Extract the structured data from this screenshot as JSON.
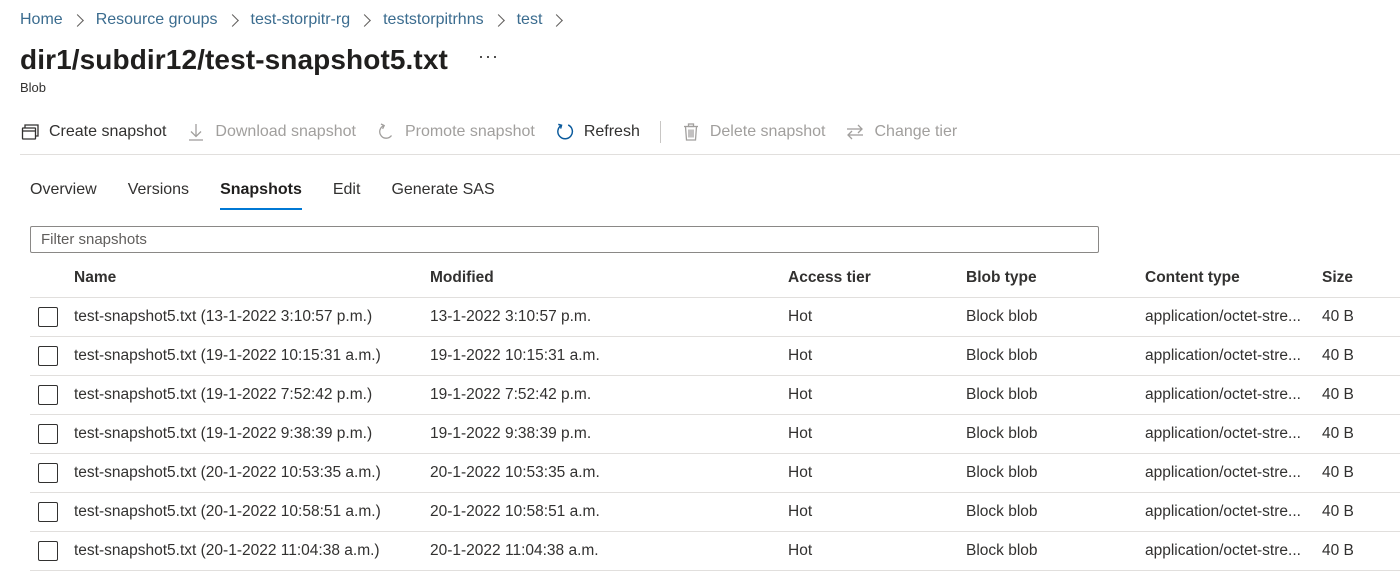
{
  "breadcrumb": [
    "Home",
    "Resource groups",
    "test-storpitr-rg",
    "teststorpitrhns",
    "test"
  ],
  "page": {
    "title": "dir1/subdir12/test-snapshot5.txt",
    "subtitle": "Blob",
    "more": "···"
  },
  "toolbar": {
    "create_snapshot": "Create snapshot",
    "download_snapshot": "Download snapshot",
    "promote_snapshot": "Promote snapshot",
    "refresh": "Refresh",
    "delete_snapshot": "Delete snapshot",
    "change_tier": "Change tier"
  },
  "tabs": [
    "Overview",
    "Versions",
    "Snapshots",
    "Edit",
    "Generate SAS"
  ],
  "active_tab": "Snapshots",
  "filter": {
    "placeholder": "Filter snapshots",
    "value": ""
  },
  "table": {
    "columns": [
      "Name",
      "Modified",
      "Access tier",
      "Blob type",
      "Content type",
      "Size"
    ],
    "rows": [
      [
        "test-snapshot5.txt (13-1-2022 3:10:57 p.m.)",
        "13-1-2022 3:10:57 p.m.",
        "Hot",
        "Block blob",
        "application/octet-stre...",
        "40 B"
      ],
      [
        "test-snapshot5.txt (19-1-2022 10:15:31 a.m.)",
        "19-1-2022 10:15:31 a.m.",
        "Hot",
        "Block blob",
        "application/octet-stre...",
        "40 B"
      ],
      [
        "test-snapshot5.txt (19-1-2022 7:52:42 p.m.)",
        "19-1-2022 7:52:42 p.m.",
        "Hot",
        "Block blob",
        "application/octet-stre...",
        "40 B"
      ],
      [
        "test-snapshot5.txt (19-1-2022 9:38:39 p.m.)",
        "19-1-2022 9:38:39 p.m.",
        "Hot",
        "Block blob",
        "application/octet-stre...",
        "40 B"
      ],
      [
        "test-snapshot5.txt (20-1-2022 10:53:35 a.m.)",
        "20-1-2022 10:53:35 a.m.",
        "Hot",
        "Block blob",
        "application/octet-stre...",
        "40 B"
      ],
      [
        "test-snapshot5.txt (20-1-2022 10:58:51 a.m.)",
        "20-1-2022 10:58:51 a.m.",
        "Hot",
        "Block blob",
        "application/octet-stre...",
        "40 B"
      ],
      [
        "test-snapshot5.txt (20-1-2022 11:04:38 a.m.)",
        "20-1-2022 11:04:38 a.m.",
        "Hot",
        "Block blob",
        "application/octet-stre...",
        "40 B"
      ]
    ]
  },
  "colors": {
    "link": "#3b6c8f",
    "accent": "#0078d4",
    "disabled": "#a19f9d",
    "text": "#323130"
  },
  "icons": {
    "create_snapshot": "create-snapshot-icon",
    "download_snapshot": "download-icon",
    "promote_snapshot": "promote-icon",
    "refresh": "refresh-icon",
    "delete_snapshot": "trash-icon",
    "change_tier": "swap-arrows-icon"
  }
}
